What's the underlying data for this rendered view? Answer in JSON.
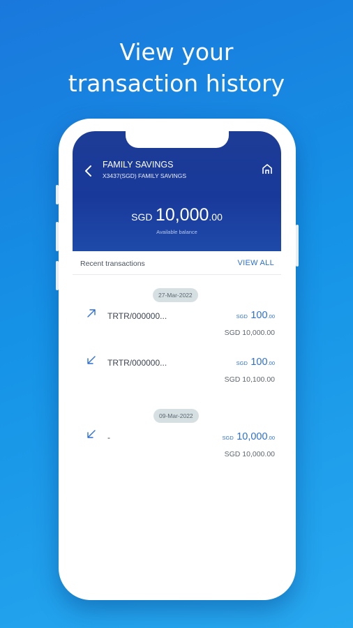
{
  "headline": {
    "line1": "View your",
    "line2": "transaction history"
  },
  "account": {
    "title": "FAMILY SAVINGS",
    "subtitle": "X3437(SGD) FAMILY SAVINGS",
    "balance_currency": "SGD",
    "balance_main": "10,000",
    "balance_decimal": ".00",
    "balance_label": "Available balance"
  },
  "recent": {
    "label": "Recent transactions",
    "view_all": "VIEW ALL"
  },
  "groups": [
    {
      "date": "27-Mar-2022",
      "transactions": [
        {
          "direction": "outgoing",
          "icon": "arrow-up-right-icon",
          "reference": "TRTR/000000...",
          "amount_currency": "SGD",
          "amount_main": "100",
          "amount_decimal": ".00",
          "balance_after": "SGD 10,000.00"
        },
        {
          "direction": "incoming",
          "icon": "arrow-down-left-icon",
          "reference": "TRTR/000000...",
          "amount_currency": "SGD",
          "amount_main": "100",
          "amount_decimal": ".00",
          "balance_after": "SGD 10,100.00"
        }
      ]
    },
    {
      "date": "09-Mar-2022",
      "transactions": [
        {
          "direction": "incoming",
          "icon": "arrow-down-left-icon",
          "reference": "-",
          "amount_currency": "SGD",
          "amount_main": "10,000",
          "amount_decimal": ".00",
          "balance_after": "SGD 10,000.00"
        }
      ]
    }
  ],
  "colors": {
    "background": "#1a8be2",
    "header": "#1d3c96",
    "accent": "#2e6fd3",
    "date_pill": "#d6e0e3"
  }
}
